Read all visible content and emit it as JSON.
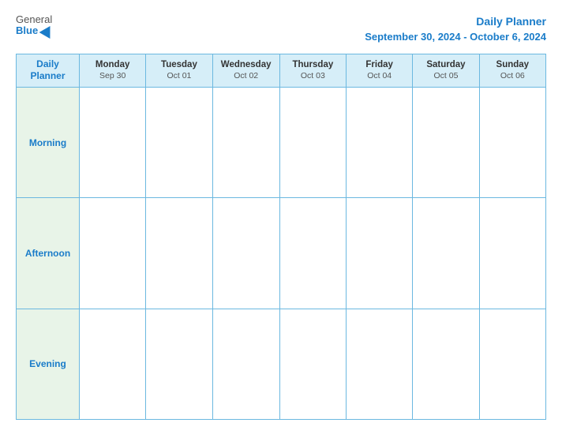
{
  "header": {
    "logo_general": "General",
    "logo_blue": "Blue",
    "title_main": "Daily Planner",
    "title_date": "September 30, 2024 - October 6, 2024"
  },
  "table": {
    "col_header_first_line1": "Daily",
    "col_header_first_line2": "Planner",
    "columns": [
      {
        "day": "Monday",
        "date": "Sep 30"
      },
      {
        "day": "Tuesday",
        "date": "Oct 01"
      },
      {
        "day": "Wednesday",
        "date": "Oct 02"
      },
      {
        "day": "Thursday",
        "date": "Oct 03"
      },
      {
        "day": "Friday",
        "date": "Oct 04"
      },
      {
        "day": "Saturday",
        "date": "Oct 05"
      },
      {
        "day": "Sunday",
        "date": "Oct 06"
      }
    ],
    "rows": [
      {
        "label": "Morning"
      },
      {
        "label": "Afternoon"
      },
      {
        "label": "Evening"
      }
    ]
  }
}
